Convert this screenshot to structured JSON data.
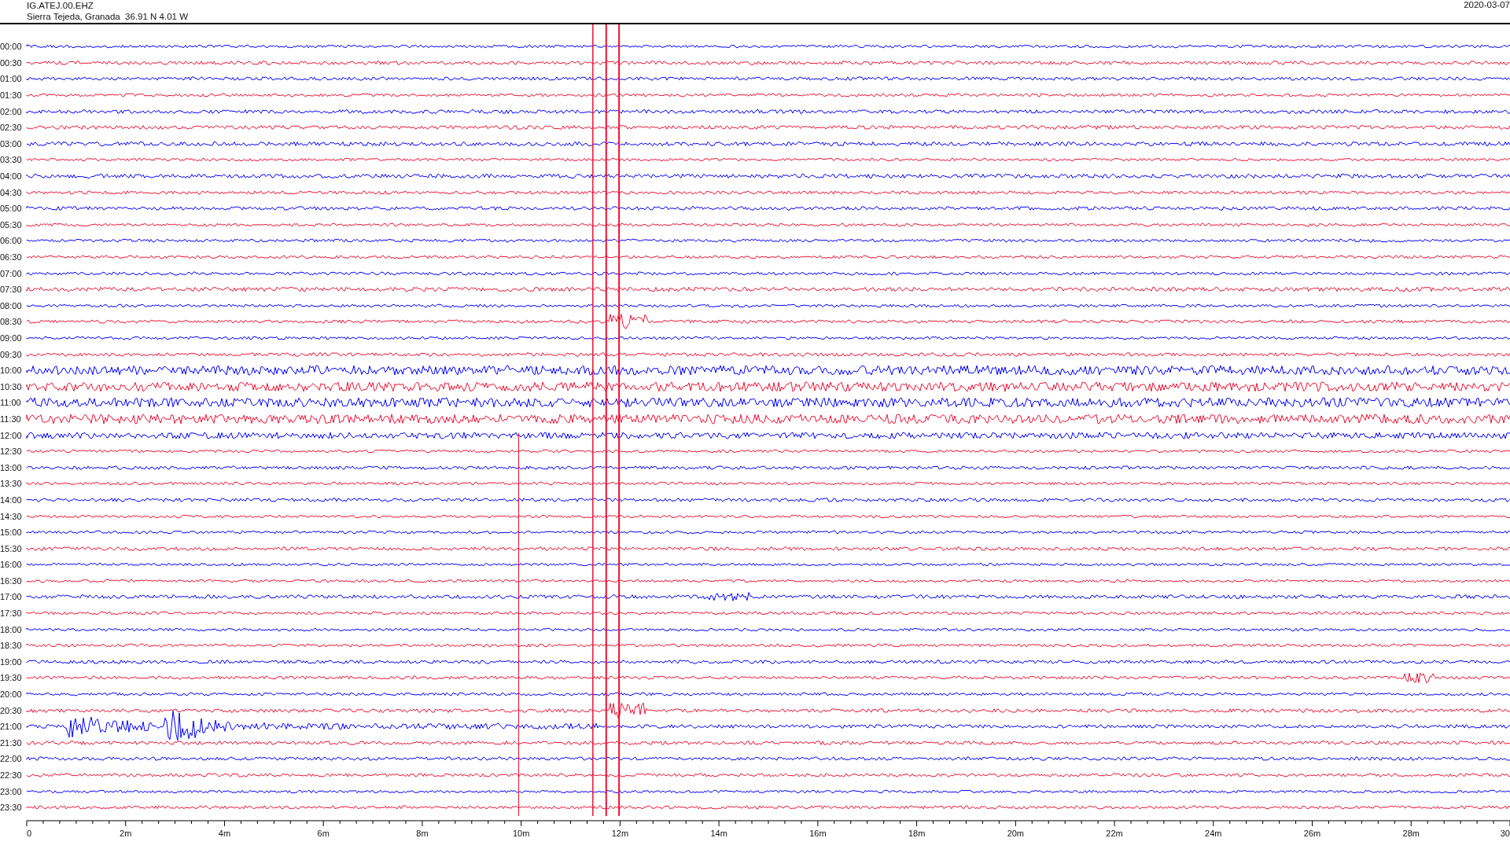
{
  "header": {
    "station": "IG.ATEJ.00.EHZ",
    "location": "Sierra Tejeda, Granada  36.91 N 4.01 W",
    "date": "2020-03-07"
  },
  "rows": [
    {
      "label": "00:00",
      "color": "#0000ff"
    },
    {
      "label": "00:30",
      "color": "#ee1133"
    },
    {
      "label": "01:00",
      "color": "#0000ff"
    },
    {
      "label": "01:30",
      "color": "#ee1133"
    },
    {
      "label": "02:00",
      "color": "#0000ff"
    },
    {
      "label": "02:30",
      "color": "#ee1133"
    },
    {
      "label": "03:00",
      "color": "#0000ff"
    },
    {
      "label": "03:30",
      "color": "#ee1133"
    },
    {
      "label": "04:00",
      "color": "#0000ff"
    },
    {
      "label": "04:30",
      "color": "#ee1133"
    },
    {
      "label": "05:00",
      "color": "#0000ff"
    },
    {
      "label": "05:30",
      "color": "#ee1133"
    },
    {
      "label": "06:00",
      "color": "#0000ff"
    },
    {
      "label": "06:30",
      "color": "#ee1133"
    },
    {
      "label": "07:00",
      "color": "#0000ff"
    },
    {
      "label": "07:30",
      "color": "#ee1133"
    },
    {
      "label": "08:00",
      "color": "#0000ff"
    },
    {
      "label": "08:30",
      "color": "#ee1133"
    },
    {
      "label": "09:00",
      "color": "#0000ff"
    },
    {
      "label": "09:30",
      "color": "#ee1133"
    },
    {
      "label": "10:00",
      "color": "#0000ff"
    },
    {
      "label": "10:30",
      "color": "#ee1133"
    },
    {
      "label": "11:00",
      "color": "#0000ff"
    },
    {
      "label": "11:30",
      "color": "#ee1133"
    },
    {
      "label": "12:00",
      "color": "#0000ff"
    },
    {
      "label": "12:30",
      "color": "#ee1133"
    },
    {
      "label": "13:00",
      "color": "#0000ff"
    },
    {
      "label": "13:30",
      "color": "#ee1133"
    },
    {
      "label": "14:00",
      "color": "#0000ff"
    },
    {
      "label": "14:30",
      "color": "#ee1133"
    },
    {
      "label": "15:00",
      "color": "#0000ff"
    },
    {
      "label": "15:30",
      "color": "#ee1133"
    },
    {
      "label": "16:00",
      "color": "#0000ff"
    },
    {
      "label": "16:30",
      "color": "#ee1133"
    },
    {
      "label": "17:00",
      "color": "#0000ff"
    },
    {
      "label": "17:30",
      "color": "#ee1133"
    },
    {
      "label": "18:00",
      "color": "#0000ff"
    },
    {
      "label": "18:30",
      "color": "#ee1133"
    },
    {
      "label": "19:00",
      "color": "#0000ff"
    },
    {
      "label": "19:30",
      "color": "#ee1133"
    },
    {
      "label": "20:00",
      "color": "#0000ff"
    },
    {
      "label": "20:30",
      "color": "#ee1133"
    },
    {
      "label": "21:00",
      "color": "#0000ff"
    },
    {
      "label": "21:30",
      "color": "#ee1133"
    },
    {
      "label": "22:00",
      "color": "#0000ff"
    },
    {
      "label": "22:30",
      "color": "#ee1133"
    },
    {
      "label": "23:00",
      "color": "#0000ff"
    },
    {
      "label": "23:30",
      "color": "#ee1133"
    }
  ],
  "x_axis": {
    "ticks": [
      "0",
      "2m",
      "4m",
      "6m",
      "8m",
      "10m",
      "12m",
      "14m",
      "16m",
      "18m",
      "20m",
      "22m",
      "24m",
      "26m",
      "28m",
      "30"
    ]
  }
}
